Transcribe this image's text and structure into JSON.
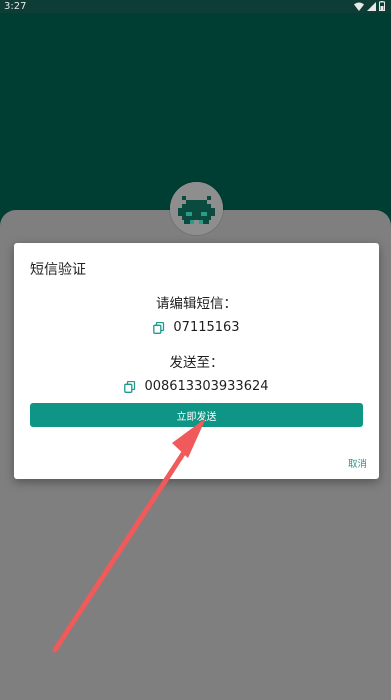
{
  "status_bar": {
    "time": "3:27",
    "icons": [
      "wifi-icon",
      "signal-icon",
      "battery-icon"
    ]
  },
  "dialog": {
    "title": "短信验证",
    "edit_label": "请编辑短信：",
    "sms_code": "07115163",
    "send_to_label": "发送至：",
    "phone_number": "008613303933624",
    "send_button_label": "立即发送",
    "cancel_label": "取消"
  },
  "colors": {
    "header": "#003d33",
    "overlay": "#7f7f7f",
    "primary": "#0f9585",
    "arrow": "#f05a5a"
  }
}
